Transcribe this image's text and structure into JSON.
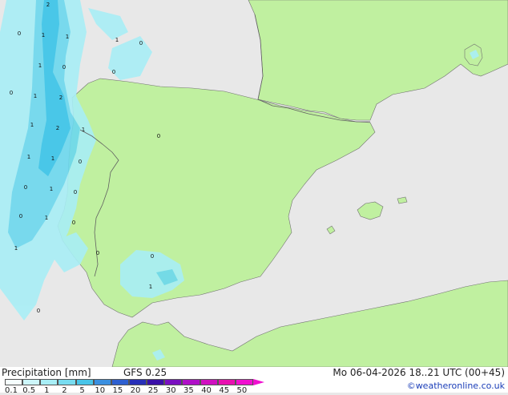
{
  "map": {
    "colors": {
      "sea": "#e8e8e8",
      "land": "#c0f0a0",
      "border": "#606060",
      "precip_light": "#a8eef6",
      "precip_mid": "#6cd8ee",
      "precip_heavy": "#38c4e8"
    },
    "point_values": [
      "2",
      "0",
      "1",
      "1",
      "1",
      "0",
      "0",
      "1",
      "0",
      "0",
      "2",
      "1",
      "2",
      "1",
      "1",
      "1",
      "1",
      "0",
      "0",
      "1",
      "0",
      "0",
      "1",
      "0",
      "1",
      "0",
      "0",
      "0",
      "1",
      "0"
    ]
  },
  "legend": {
    "title": "Precipitation [mm]",
    "model": "GFS 0.25",
    "datetime": "Mo 06-04-2026 18..21 UTC (00+45)",
    "credit": "©weatheronline.co.uk",
    "ticks": [
      "0.1",
      "0.5",
      "1",
      "2",
      "5",
      "10",
      "15",
      "20",
      "25",
      "30",
      "35",
      "40",
      "45",
      "50"
    ],
    "colors": [
      "#f5fefe",
      "#cdf6fa",
      "#a8eef6",
      "#78dcf0",
      "#48c4e8",
      "#3a8fe0",
      "#2e5fd0",
      "#2830b8",
      "#3a10a8",
      "#7a10c0",
      "#b010c8",
      "#d010c0",
      "#e810b0",
      "#f010d0"
    ]
  }
}
